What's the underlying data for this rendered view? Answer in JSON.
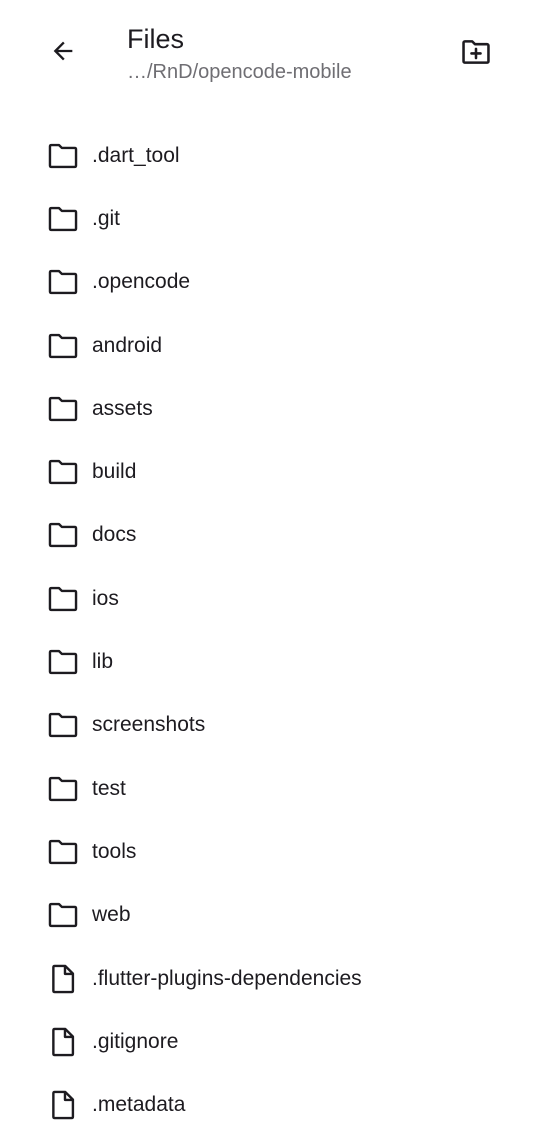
{
  "header": {
    "title": "Files",
    "path": "…/RnD/opencode-mobile",
    "back_icon": "arrow-back-icon",
    "new_folder_icon": "create-new-folder-icon"
  },
  "entries": [
    {
      "name": ".dart_tool",
      "type": "folder"
    },
    {
      "name": ".git",
      "type": "folder"
    },
    {
      "name": ".opencode",
      "type": "folder"
    },
    {
      "name": "android",
      "type": "folder"
    },
    {
      "name": "assets",
      "type": "folder"
    },
    {
      "name": "build",
      "type": "folder"
    },
    {
      "name": "docs",
      "type": "folder"
    },
    {
      "name": "ios",
      "type": "folder"
    },
    {
      "name": "lib",
      "type": "folder"
    },
    {
      "name": "screenshots",
      "type": "folder"
    },
    {
      "name": "test",
      "type": "folder"
    },
    {
      "name": "tools",
      "type": "folder"
    },
    {
      "name": "web",
      "type": "folder"
    },
    {
      "name": ".flutter-plugins-dependencies",
      "type": "file"
    },
    {
      "name": ".gitignore",
      "type": "file"
    },
    {
      "name": ".metadata",
      "type": "file"
    }
  ],
  "colors": {
    "text": "#1d1b20",
    "secondary_text": "#6f6e73",
    "background": "#ffffff"
  }
}
